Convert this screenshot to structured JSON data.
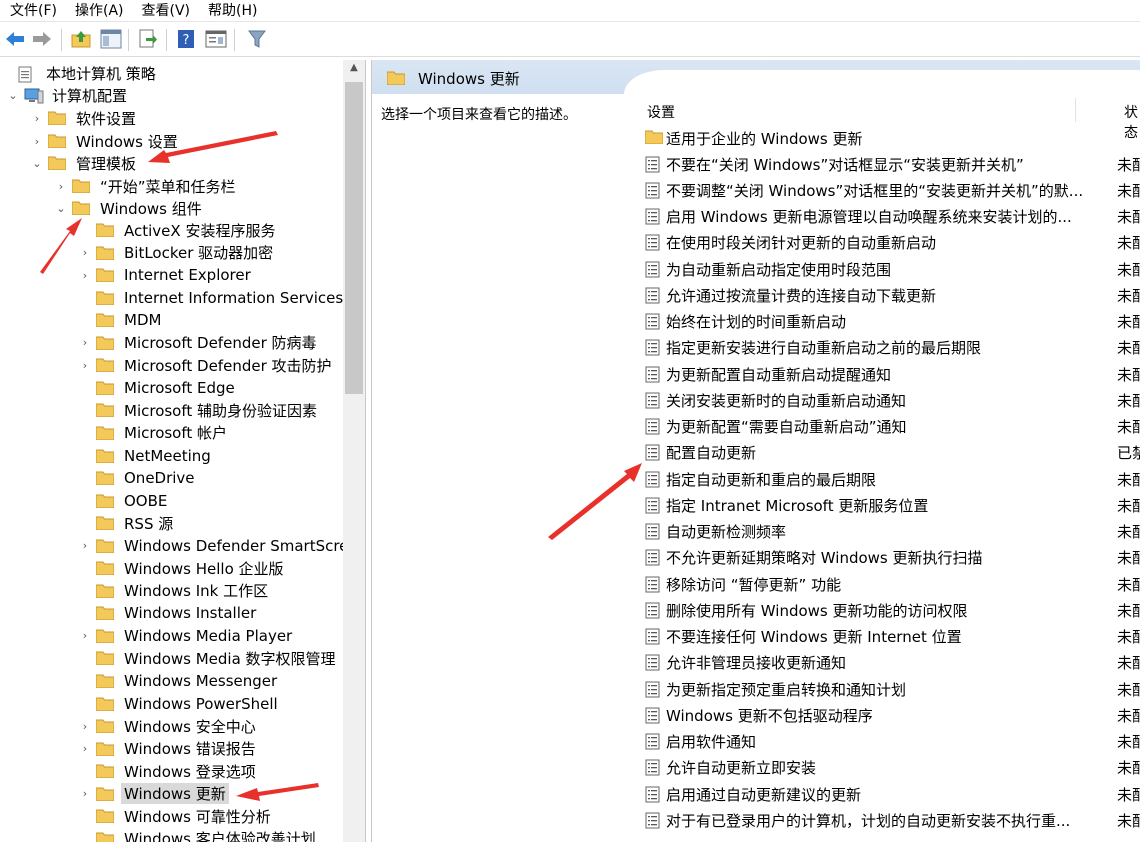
{
  "menubar": {
    "file": "文件(F)",
    "action": "操作(A)",
    "view": "查看(V)",
    "help": "帮助(H)"
  },
  "toolbar": {
    "buttons": [
      "back-icon",
      "forward-icon",
      "up-folder-icon",
      "show-hide-tree-icon",
      "export-list-icon",
      "help-icon",
      "properties-icon",
      "filter-icon"
    ]
  },
  "colors": {
    "header_bg": "#d4e3f3",
    "folder": "#f3c95a",
    "arrow": "#e8312a",
    "selected": "#d9d9d9"
  },
  "tree": {
    "root": "本地计算机 策略",
    "computer_config": "计算机配置",
    "software_settings": "软件设置",
    "windows_settings": "Windows 设置",
    "admin_templates": "管理模板",
    "start_menu": "“开始”菜单和任务栏",
    "windows_components": "Windows 组件",
    "items": [
      {
        "label": "ActiveX 安装程序服务",
        "expandable": false
      },
      {
        "label": "BitLocker 驱动器加密",
        "expandable": true
      },
      {
        "label": "Internet Explorer",
        "expandable": true
      },
      {
        "label": "Internet Information Services",
        "expandable": false
      },
      {
        "label": "MDM",
        "expandable": false
      },
      {
        "label": "Microsoft Defender 防病毒",
        "expandable": true
      },
      {
        "label": "Microsoft Defender 攻击防护",
        "expandable": true
      },
      {
        "label": "Microsoft Edge",
        "expandable": false
      },
      {
        "label": "Microsoft 辅助身份验证因素",
        "expandable": false
      },
      {
        "label": "Microsoft 帐户",
        "expandable": false
      },
      {
        "label": "NetMeeting",
        "expandable": false
      },
      {
        "label": "OneDrive",
        "expandable": false
      },
      {
        "label": "OOBE",
        "expandable": false
      },
      {
        "label": "RSS 源",
        "expandable": false
      },
      {
        "label": "Windows Defender SmartScreen",
        "expandable": true
      },
      {
        "label": "Windows Hello 企业版",
        "expandable": false
      },
      {
        "label": "Windows Ink 工作区",
        "expandable": false
      },
      {
        "label": "Windows Installer",
        "expandable": false
      },
      {
        "label": "Windows Media Player",
        "expandable": true
      },
      {
        "label": "Windows Media 数字权限管理",
        "expandable": false
      },
      {
        "label": "Windows Messenger",
        "expandable": false
      },
      {
        "label": "Windows PowerShell",
        "expandable": false
      },
      {
        "label": "Windows 安全中心",
        "expandable": true
      },
      {
        "label": "Windows 错误报告",
        "expandable": true
      },
      {
        "label": "Windows 登录选项",
        "expandable": false
      },
      {
        "label": "Windows 更新",
        "expandable": true,
        "selected": true
      },
      {
        "label": "Windows 可靠性分析",
        "expandable": false
      },
      {
        "label": "Windows 客户体验改善计划",
        "expandable": false
      }
    ]
  },
  "details": {
    "header_title": "Windows 更新",
    "description": "选择一个项目来查看它的描述。",
    "col_setting": "设置",
    "col_state": "状态",
    "folder_row": "适用于企业的 Windows 更新",
    "settings": [
      {
        "name": "不要在“关闭 Windows”对话框显示“安装更新并关机”",
        "state": "未配置"
      },
      {
        "name": "不要调整“关闭 Windows”对话框里的“安装更新并关机”的默...",
        "state": "未配置"
      },
      {
        "name": "启用 Windows 更新电源管理以自动唤醒系统来安装计划的...",
        "state": "未配置"
      },
      {
        "name": "在使用时段关闭针对更新的自动重新启动",
        "state": "未配置"
      },
      {
        "name": "为自动重新启动指定使用时段范围",
        "state": "未配置"
      },
      {
        "name": "允许通过按流量计费的连接自动下载更新",
        "state": "未配置"
      },
      {
        "name": "始终在计划的时间重新启动",
        "state": "未配置"
      },
      {
        "name": "指定更新安装进行自动重新启动之前的最后期限",
        "state": "未配置"
      },
      {
        "name": "为更新配置自动重新启动提醒通知",
        "state": "未配置"
      },
      {
        "name": "关闭安装更新时的自动重新启动通知",
        "state": "未配置"
      },
      {
        "name": "为更新配置“需要自动重新启动”通知",
        "state": "未配置"
      },
      {
        "name": "配置自动更新",
        "state": "已禁用"
      },
      {
        "name": "指定自动更新和重启的最后期限",
        "state": "未配置"
      },
      {
        "name": "指定 Intranet Microsoft 更新服务位置",
        "state": "未配置"
      },
      {
        "name": "自动更新检测频率",
        "state": "未配置"
      },
      {
        "name": "不允许更新延期策略对 Windows 更新执行扫描",
        "state": "未配置"
      },
      {
        "name": "移除访问 “暂停更新” 功能",
        "state": "未配置"
      },
      {
        "name": "删除使用所有 Windows 更新功能的访问权限",
        "state": "未配置"
      },
      {
        "name": "不要连接任何 Windows 更新 Internet 位置",
        "state": "未配置"
      },
      {
        "name": "允许非管理员接收更新通知",
        "state": "未配置"
      },
      {
        "name": "为更新指定预定重启转换和通知计划",
        "state": "未配置"
      },
      {
        "name": "Windows 更新不包括驱动程序",
        "state": "未配置"
      },
      {
        "name": "启用软件通知",
        "state": "未配置"
      },
      {
        "name": "允许自动更新立即安装",
        "state": "未配置"
      },
      {
        "name": "启用通过自动更新建议的更新",
        "state": "未配置"
      },
      {
        "name": "对于有已登录用户的计算机，计划的自动更新安装不执行重...",
        "state": "未配置"
      }
    ]
  }
}
